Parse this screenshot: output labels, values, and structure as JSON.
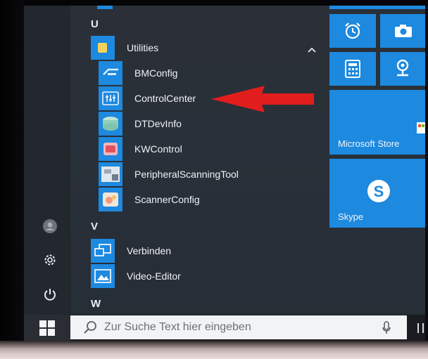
{
  "start_menu": {
    "section_u": "U",
    "folder": {
      "label": "Utilities",
      "expanded_icon": "chevron-up-icon"
    },
    "utilities_items": [
      {
        "label": "BMConfig",
        "icon": "bmconfig-icon"
      },
      {
        "label": "ControlCenter",
        "icon": "controlcenter-icon"
      },
      {
        "label": "DTDevInfo",
        "icon": "dtdevinfo-icon"
      },
      {
        "label": "KWControl",
        "icon": "kwcontrol-icon"
      },
      {
        "label": "PeripheralScanningTool",
        "icon": "peripheral-scanning-icon"
      },
      {
        "label": "ScannerConfig",
        "icon": "scannerconfig-icon"
      }
    ],
    "section_v": "V",
    "v_items": [
      {
        "label": "Verbinden",
        "icon": "connect-icon"
      },
      {
        "label": "Video-Editor",
        "icon": "video-editor-icon"
      }
    ],
    "section_w": "W"
  },
  "rail": {
    "icons": [
      "user-avatar-icon",
      "settings-gear-icon",
      "power-icon"
    ]
  },
  "tiles": {
    "alarm_icon": "alarm-clock-icon",
    "camera_icon": "camera-icon",
    "calculator_icon": "calculator-icon",
    "maps_icon": "maps-pin-icon",
    "store_label": "Microsoft Store",
    "skype_label": "Skype"
  },
  "taskbar": {
    "start_icon": "windows-logo-icon",
    "search_placeholder": "Zur Suche Text hier eingeben",
    "search_icon": "search-icon",
    "mic_icon": "microphone-icon"
  },
  "colors": {
    "accent": "#1d89df",
    "arrow": "#e11d1d",
    "menu_bg": "#272d35",
    "taskbar_bg": "#1a1c21"
  }
}
